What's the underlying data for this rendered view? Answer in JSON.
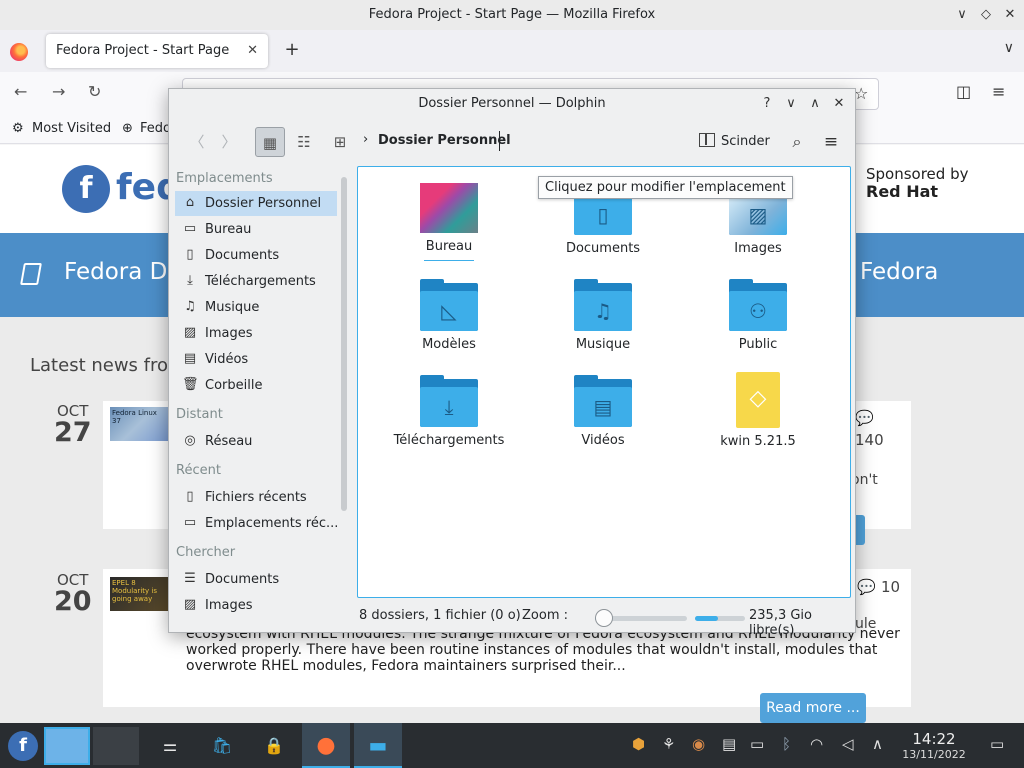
{
  "firefox": {
    "window_title": "Fedora Project - Start Page — Mozilla Firefox",
    "tab_title": "Fedora Project - Start Page",
    "bookmarks": [
      "Most Visited",
      "Fedo"
    ]
  },
  "fedora_page": {
    "logo_text": "fed",
    "sponsor_line1": "Sponsored by",
    "sponsor_line2": "Red Hat",
    "band_left": "Fedora D",
    "band_right": "Fedora",
    "latest_news": "Latest news from",
    "news": [
      {
        "month": "OCT",
        "day": "27",
        "thumb": "Fedora Linux 37",
        "comments": "140",
        "snippet": "on't"
      },
      {
        "month": "OCT",
        "day": "20",
        "thumb": "EPEL 8 Modularity is going away",
        "comments": "10",
        "snippet": "ule"
      }
    ],
    "news2_text": "ecosystem with RHEL modules. The strange mixture of Fedora ecosystem and RHEL modularity never worked properly. There have been routine instances of modules that wouldn't install, modules that overwrote RHEL modules, Fedora maintainers surprised their...",
    "read_more": "Read more ..."
  },
  "dolphin": {
    "title": "Dossier Personnel — Dolphin",
    "location": "Dossier Personnel",
    "split_label": "Scinder",
    "tooltip": "Cliquez pour modifier l'emplacement",
    "places": {
      "headings": [
        "Emplacements",
        "Distant",
        "Récent",
        "Chercher"
      ],
      "emplacements": [
        "Dossier Personnel",
        "Bureau",
        "Documents",
        "Téléchargements",
        "Musique",
        "Images",
        "Vidéos",
        "Corbeille"
      ],
      "distant": [
        "Réseau"
      ],
      "recent": [
        "Fichiers récents",
        "Emplacements réc..."
      ],
      "chercher": [
        "Documents",
        "Images"
      ]
    },
    "items": [
      "Bureau",
      "Documents",
      "Images",
      "Modèles",
      "Musique",
      "Public",
      "Téléchargements",
      "Vidéos",
      "kwin 5.21.5"
    ],
    "status": "8 dossiers, 1 fichier (0 o)",
    "zoom_label": "Zoom :",
    "zoom_level": 0.1,
    "disk_used_fraction": 0.45,
    "free_space": "235,3 Gio libre(s)"
  },
  "taskbar": {
    "time": "14:22",
    "date": "13/11/2022"
  }
}
